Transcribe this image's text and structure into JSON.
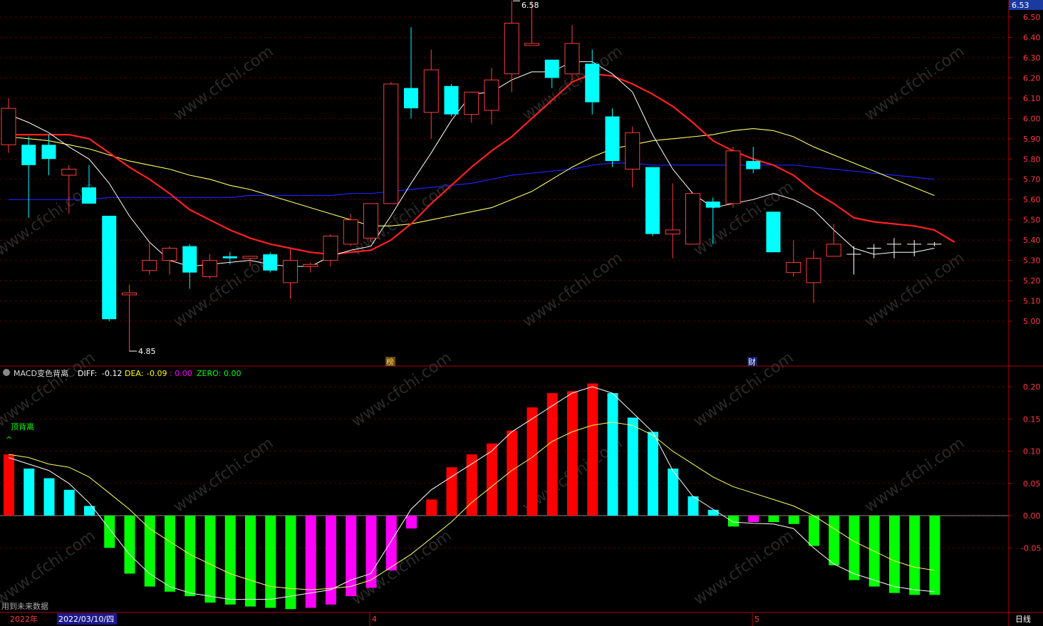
{
  "price_axis": {
    "top_label": "6.53",
    "ticks": [
      "6.50",
      "6.40",
      "6.30",
      "6.20",
      "6.10",
      "6.00",
      "5.90",
      "5.80",
      "5.70",
      "5.60",
      "5.50",
      "5.40",
      "5.30",
      "5.20",
      "5.10",
      "5.00"
    ]
  },
  "price_annotations": {
    "high": "6.58",
    "low": "4.85",
    "marker_1": "榜",
    "marker_2": "财"
  },
  "indicator": {
    "name": "MACD变色背离",
    "diff_label": "DIFF:",
    "diff_value": "-0.12",
    "dea_label": "DEA:",
    "dea_value": "-0.09",
    "macd_value": ": 0.00",
    "zero_label": "ZERO:",
    "zero_value": "0.00",
    "signal": "顶背离",
    "ticks": [
      "0.20",
      "0.15",
      "0.10",
      "0.05",
      "0.00",
      "-0.05"
    ]
  },
  "footer": {
    "note": "用到未来数据",
    "year": "2022年",
    "cursor_date": "2022/03/10/四",
    "month_4": "4",
    "month_5": "5",
    "period": "日线"
  },
  "watermark": "www.cfchi.com",
  "colors": {
    "up": "#ff3c3c",
    "down": "#00ffff",
    "macd_pos_rise": "#ff0000",
    "macd_pos_fall": "#00ffff",
    "macd_neg_fall": "#00ff00",
    "macd_neg_rise": "#ff00ff",
    "ma5": "#ffffff",
    "ma10": "#ff2020",
    "ma20": "#ffff66",
    "ma60": "#2020ff"
  },
  "chart_data": {
    "type": "candlestick",
    "ylim": [
      4.85,
      6.58
    ],
    "candles": [
      {
        "o": 5.87,
        "h": 6.1,
        "l": 5.83,
        "c": 6.05
      },
      {
        "o": 5.87,
        "h": 5.91,
        "l": 5.51,
        "c": 5.77
      },
      {
        "o": 5.87,
        "h": 5.92,
        "l": 5.72,
        "c": 5.8
      },
      {
        "o": 5.72,
        "h": 5.77,
        "l": 5.53,
        "c": 5.75
      },
      {
        "o": 5.66,
        "h": 5.77,
        "l": 5.59,
        "c": 5.58
      },
      {
        "o": 5.52,
        "h": 5.52,
        "l": 5.0,
        "c": 5.01
      },
      {
        "o": 5.13,
        "h": 5.18,
        "l": 4.85,
        "c": 5.14
      },
      {
        "o": 5.25,
        "h": 5.39,
        "l": 5.23,
        "c": 5.3
      },
      {
        "o": 5.3,
        "h": 5.37,
        "l": 5.23,
        "c": 5.36
      },
      {
        "o": 5.37,
        "h": 5.38,
        "l": 5.16,
        "c": 5.24
      },
      {
        "o": 5.22,
        "h": 5.33,
        "l": 5.21,
        "c": 5.3
      },
      {
        "o": 5.32,
        "h": 5.34,
        "l": 5.28,
        "c": 5.31
      },
      {
        "o": 5.31,
        "h": 5.31,
        "l": 5.27,
        "c": 5.32
      },
      {
        "o": 5.33,
        "h": 5.34,
        "l": 5.24,
        "c": 5.25
      },
      {
        "o": 5.19,
        "h": 5.36,
        "l": 5.11,
        "c": 5.3
      },
      {
        "o": 5.27,
        "h": 5.29,
        "l": 5.24,
        "c": 5.28
      },
      {
        "o": 5.3,
        "h": 5.43,
        "l": 5.27,
        "c": 5.42
      },
      {
        "o": 5.38,
        "h": 5.53,
        "l": 5.37,
        "c": 5.5
      },
      {
        "o": 5.41,
        "h": 5.58,
        "l": 5.39,
        "c": 5.58
      },
      {
        "o": 5.58,
        "h": 6.18,
        "l": 5.58,
        "c": 6.17
      },
      {
        "o": 6.15,
        "h": 6.45,
        "l": 6.0,
        "c": 6.05
      },
      {
        "o": 6.03,
        "h": 6.34,
        "l": 5.9,
        "c": 6.24
      },
      {
        "o": 6.16,
        "h": 6.17,
        "l": 6.01,
        "c": 6.02
      },
      {
        "o": 6.02,
        "h": 6.08,
        "l": 5.98,
        "c": 6.13
      },
      {
        "o": 6.04,
        "h": 6.25,
        "l": 5.97,
        "c": 6.19
      },
      {
        "o": 6.22,
        "h": 6.58,
        "l": 6.13,
        "c": 6.47
      },
      {
        "o": 6.36,
        "h": 6.58,
        "l": 6.36,
        "c": 6.37
      },
      {
        "o": 6.29,
        "h": 6.29,
        "l": 6.15,
        "c": 6.2
      },
      {
        "o": 6.22,
        "h": 6.46,
        "l": 6.19,
        "c": 6.37
      },
      {
        "o": 6.27,
        "h": 6.34,
        "l": 6.02,
        "c": 6.08
      },
      {
        "o": 6.01,
        "h": 6.05,
        "l": 5.76,
        "c": 5.79
      },
      {
        "o": 5.75,
        "h": 5.96,
        "l": 5.66,
        "c": 5.93
      },
      {
        "o": 5.76,
        "h": 5.76,
        "l": 5.42,
        "c": 5.43
      },
      {
        "o": 5.43,
        "h": 5.68,
        "l": 5.31,
        "c": 5.45
      },
      {
        "o": 5.38,
        "h": 5.63,
        "l": 5.38,
        "c": 5.63
      },
      {
        "o": 5.59,
        "h": 5.61,
        "l": 5.38,
        "c": 5.56
      },
      {
        "o": 5.58,
        "h": 5.86,
        "l": 5.56,
        "c": 5.84
      },
      {
        "o": 5.79,
        "h": 5.86,
        "l": 5.73,
        "c": 5.75
      },
      {
        "o": 5.54,
        "h": 5.54,
        "l": 5.34,
        "c": 5.34
      },
      {
        "o": 5.24,
        "h": 5.4,
        "l": 5.22,
        "c": 5.29
      },
      {
        "o": 5.19,
        "h": 5.35,
        "l": 5.09,
        "c": 5.31
      },
      {
        "o": 5.32,
        "h": 5.48,
        "l": 5.32,
        "c": 5.38
      },
      {
        "o": 5.32,
        "h": 5.37,
        "l": 5.23,
        "c": 5.33
      },
      {
        "o": 5.34,
        "h": 5.38,
        "l": 5.31,
        "c": 5.36
      },
      {
        "o": 5.37,
        "h": 5.41,
        "l": 5.31,
        "c": 5.38
      },
      {
        "o": 5.38,
        "h": 5.4,
        "l": 5.32,
        "c": 5.38
      },
      {
        "o": 5.38,
        "h": 5.39,
        "l": 5.37,
        "c": 5.38
      }
    ],
    "ma5": [
      6.02,
      5.98,
      5.93,
      5.86,
      5.8,
      5.68,
      5.52,
      5.39,
      5.3,
      5.27,
      5.28,
      5.29,
      5.3,
      5.28,
      5.27,
      5.27,
      5.32,
      5.35,
      5.37,
      5.52,
      5.68,
      5.83,
      5.99,
      6.12,
      6.13,
      6.19,
      6.23,
      6.23,
      6.28,
      6.28,
      6.22,
      6.13,
      5.92,
      5.75,
      5.63,
      5.56,
      5.58,
      5.6,
      5.63,
      5.6,
      5.55,
      5.45,
      5.36,
      5.33,
      5.34,
      5.34,
      5.36
    ],
    "ma10": [
      5.92,
      5.92,
      5.92,
      5.92,
      5.9,
      5.83,
      5.76,
      5.7,
      5.63,
      5.55,
      5.5,
      5.45,
      5.41,
      5.38,
      5.36,
      5.34,
      5.33,
      5.34,
      5.35,
      5.4,
      5.48,
      5.58,
      5.67,
      5.76,
      5.84,
      5.91,
      6.0,
      6.09,
      6.18,
      6.22,
      6.21,
      6.17,
      6.12,
      6.06,
      5.98,
      5.89,
      5.84,
      5.8,
      5.77,
      5.72,
      5.64,
      5.58,
      5.51,
      5.49,
      5.48,
      5.47,
      5.45,
      5.39
    ],
    "ma20": [
      5.91,
      5.9,
      5.89,
      5.87,
      5.85,
      5.82,
      5.79,
      5.77,
      5.75,
      5.72,
      5.7,
      5.67,
      5.65,
      5.62,
      5.59,
      5.56,
      5.53,
      5.5,
      5.47,
      5.47,
      5.48,
      5.5,
      5.52,
      5.54,
      5.56,
      5.6,
      5.64,
      5.7,
      5.76,
      5.81,
      5.85,
      5.87,
      5.89,
      5.9,
      5.91,
      5.92,
      5.94,
      5.95,
      5.94,
      5.91,
      5.86,
      5.82,
      5.78,
      5.74,
      5.7,
      5.66,
      5.62
    ],
    "ma60": [
      5.6,
      5.6,
      5.6,
      5.6,
      5.6,
      5.61,
      5.61,
      5.61,
      5.61,
      5.61,
      5.61,
      5.61,
      5.62,
      5.62,
      5.62,
      5.62,
      5.62,
      5.63,
      5.63,
      5.64,
      5.65,
      5.66,
      5.67,
      5.68,
      5.7,
      5.72,
      5.73,
      5.74,
      5.75,
      5.77,
      5.78,
      5.78,
      5.77,
      5.77,
      5.77,
      5.77,
      5.77,
      5.77,
      5.77,
      5.77,
      5.76,
      5.75,
      5.74,
      5.73,
      5.72,
      5.71,
      5.7
    ],
    "macd_hist": [
      0.095,
      0.073,
      0.058,
      0.04,
      0.015,
      -0.05,
      -0.09,
      -0.11,
      -0.118,
      -0.125,
      -0.135,
      -0.138,
      -0.141,
      -0.143,
      -0.145,
      -0.143,
      -0.138,
      -0.125,
      -0.112,
      -0.085,
      -0.02,
      0.025,
      0.075,
      0.095,
      0.112,
      0.132,
      0.168,
      0.19,
      0.193,
      0.205,
      0.19,
      0.152,
      0.13,
      0.073,
      0.03,
      0.009,
      -0.017,
      -0.01,
      -0.01,
      -0.013,
      -0.047,
      -0.077,
      -0.1,
      -0.11,
      -0.12,
      -0.123,
      -0.123,
      -0.123,
      -0.12,
      -0.119
    ],
    "diff": [
      0.09,
      0.08,
      0.07,
      0.05,
      0.02,
      -0.02,
      -0.06,
      -0.09,
      -0.11,
      -0.12,
      -0.125,
      -0.13,
      -0.13,
      -0.13,
      -0.125,
      -0.12,
      -0.115,
      -0.1,
      -0.09,
      -0.04,
      0.01,
      0.04,
      0.06,
      0.08,
      0.1,
      0.13,
      0.15,
      0.17,
      0.19,
      0.2,
      0.19,
      0.16,
      0.13,
      0.07,
      0.03,
      0.01,
      -0.01,
      -0.012,
      -0.013,
      -0.02,
      -0.05,
      -0.075,
      -0.09,
      -0.1,
      -0.11,
      -0.115,
      -0.118,
      -0.12,
      -0.12,
      -0.12
    ],
    "dea": [
      0.095,
      0.09,
      0.08,
      0.075,
      0.06,
      0.035,
      0.01,
      -0.02,
      -0.04,
      -0.06,
      -0.075,
      -0.09,
      -0.1,
      -0.11,
      -0.113,
      -0.115,
      -0.113,
      -0.11,
      -0.1,
      -0.08,
      -0.06,
      -0.035,
      -0.01,
      0.02,
      0.045,
      0.07,
      0.09,
      0.115,
      0.13,
      0.14,
      0.145,
      0.14,
      0.125,
      0.1,
      0.08,
      0.06,
      0.045,
      0.035,
      0.025,
      0.015,
      0.0,
      -0.02,
      -0.04,
      -0.055,
      -0.07,
      -0.08,
      -0.085,
      -0.09,
      -0.09,
      -0.09
    ]
  }
}
